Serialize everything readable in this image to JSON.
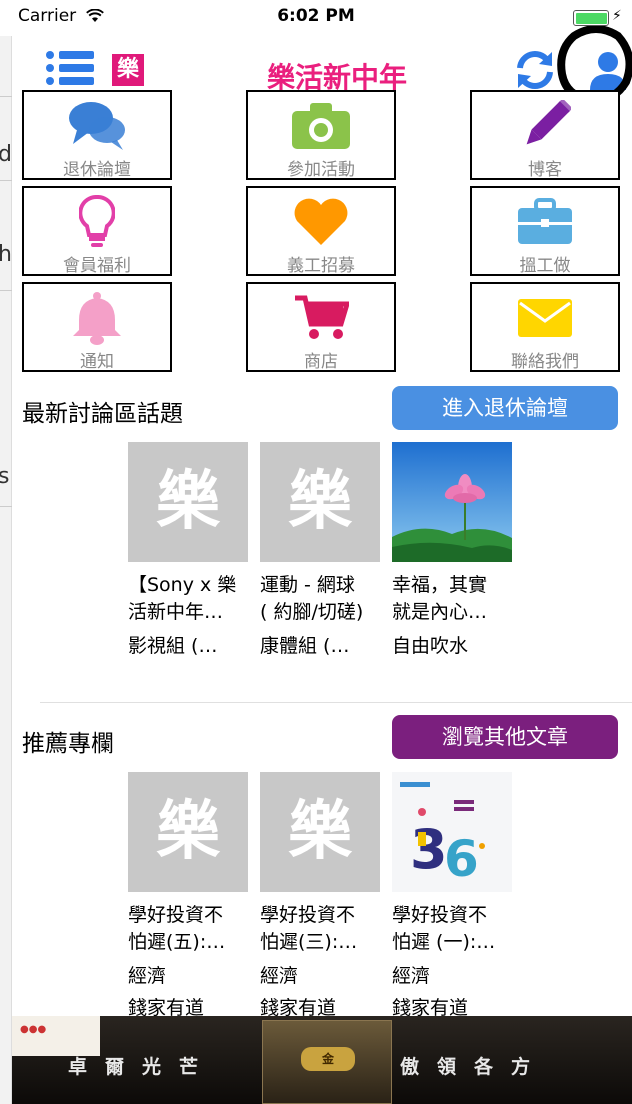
{
  "status_bar": {
    "carrier": "Carrier",
    "time": "6:02 PM"
  },
  "navbar": {
    "logo_char": "樂",
    "title": "樂活新中年",
    "icons": [
      "list-menu-icon",
      "refresh-icon",
      "user-icon"
    ]
  },
  "menu_tiles": [
    {
      "label": "退休論壇",
      "icon": "chat-bubbles-icon",
      "color": "#3a7fd5"
    },
    {
      "label": "參加活動",
      "icon": "camera-icon",
      "color": "#8bc34a"
    },
    {
      "label": "博客",
      "icon": "pencil-icon",
      "color": "#7b1fa2"
    },
    {
      "label": "會員福利",
      "icon": "lightbulb-icon",
      "color": "#e23fa8"
    },
    {
      "label": "義工招募",
      "icon": "heart-icon",
      "color": "#ff9800"
    },
    {
      "label": "搵工做",
      "icon": "briefcase-icon",
      "color": "#5aaee0"
    },
    {
      "label": "通知",
      "icon": "bell-icon",
      "color": "#f4a0c8"
    },
    {
      "label": "商店",
      "icon": "cart-icon",
      "color": "#d81b60"
    },
    {
      "label": "聯絡我們",
      "icon": "envelope-icon",
      "color": "#ffd600"
    }
  ],
  "forum_section": {
    "title": "最新討論區話題",
    "button": "進入退休論壇",
    "button_color": "#4a90e2",
    "cards": [
      {
        "thumb": "樂",
        "title": "【Sony x 樂\n活新中年…",
        "category": "影視組 (…",
        "author": ""
      },
      {
        "thumb": "樂",
        "title": "運動 - 網球\n( 約腳/切磋)",
        "category": "康體組 (…",
        "author": ""
      },
      {
        "thumb": "",
        "title": "幸福，其實\n就是內心…",
        "category": "自由吹水",
        "author": ""
      }
    ]
  },
  "column_section": {
    "title": "推薦專欄",
    "button": "瀏覽其他文章",
    "button_color": "#7b1f7e",
    "cards": [
      {
        "thumb": "樂",
        "title": "學好投資不\n怕遲(五):…",
        "category": "經濟",
        "author": "錢家有道"
      },
      {
        "thumb": "樂",
        "title": "學好投資不\n怕遲(三):…",
        "category": "經濟",
        "author": "錢家有道"
      },
      {
        "thumb": "",
        "title": "學好投資不\n怕遲 (一):…",
        "category": "經濟",
        "author": "錢家有道"
      }
    ]
  },
  "banner": {
    "left_text": "卓爾光芒",
    "right_text": "傲領各方"
  }
}
